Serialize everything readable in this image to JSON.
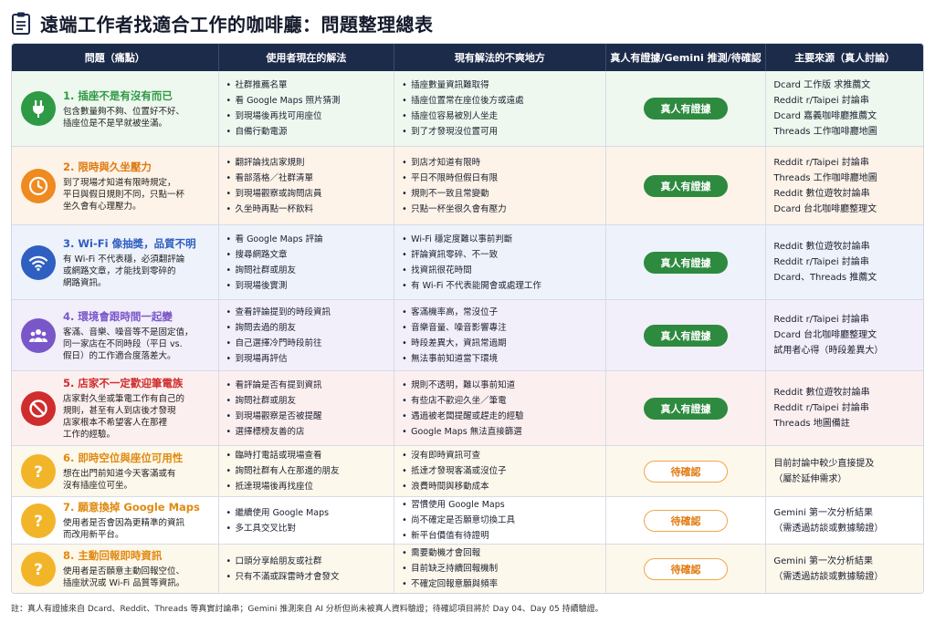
{
  "title": "遠端工作者找適合工作的咖啡廳：問題整理總表",
  "headers": [
    "問題（痛點）",
    "使用者現在的解法",
    "現有解法的不爽地方",
    "真人有證據/Gemini 推測/待確認",
    "主要來源（真人討論）"
  ],
  "colors": {
    "header_bg": "#1c2b4a",
    "green": "#2f9a45",
    "orange": "#ee8a1f",
    "blue": "#2f5fc0",
    "purple": "#7a57c8",
    "red": "#cf2d2d",
    "yellow": "#f2b52a"
  },
  "rows": [
    {
      "icon": "plug-icon",
      "title": "1. 插座不是有沒有而已",
      "desc": [
        "包含數量夠不夠、位置好不好、",
        "插座位是不是早就被坐滿。"
      ],
      "solutions": [
        "社群推薦名單",
        "看 Google Maps 照片猜測",
        "到現場後再找可用座位",
        "自備行動電源"
      ],
      "pains": [
        "插座數量資訊難取得",
        "插座位置常在座位後方或遠處",
        "插座位容易被別人坐走",
        "到了才發現沒位置可用"
      ],
      "status": "真人有證據",
      "sources": [
        "Dcard 工作版 求推薦文",
        "Reddit r/Taipei 討論串",
        "Dcard 嘉義咖啡廳推薦文",
        "Threads 工作咖啡廳地圖"
      ]
    },
    {
      "icon": "clock-icon",
      "title": "2. 限時與久坐壓力",
      "desc": [
        "到了現場才知道有限時規定，",
        "平日與假日規則不同，只點一杯",
        "坐久會有心理壓力。"
      ],
      "solutions": [
        "翻評論找店家規則",
        "看部落格／社群清單",
        "到現場觀察或詢問店員",
        "久坐時再點一杯飲料"
      ],
      "pains": [
        "到店才知道有限時",
        "平日不限時但假日有限",
        "規則不一致且常變動",
        "只點一杯坐很久會有壓力"
      ],
      "status": "真人有證據",
      "sources": [
        "Reddit r/Taipei 討論串",
        "Threads 工作咖啡廳地圖",
        "Reddit 數位遊牧討論串",
        "Dcard 台北咖啡廳整理文"
      ]
    },
    {
      "icon": "wifi-icon",
      "title": "3. Wi-Fi 像抽獎，品質不明",
      "desc": [
        "有 Wi-Fi 不代表穩，必須翻評論",
        "或網路文章，才能找到零碎的",
        "網路資訊。"
      ],
      "solutions": [
        "看 Google Maps 評論",
        "搜尋網路文章",
        "詢問社群或朋友",
        "到現場後實測"
      ],
      "pains": [
        "Wi-Fi 穩定度難以事前判斷",
        "評論資訊零碎、不一致",
        "找資訊很花時間",
        "有 Wi-Fi 不代表能開會或處理工作"
      ],
      "status": "真人有證據",
      "sources": [
        "Reddit 數位遊牧討論串",
        "Reddit r/Taipei 討論串",
        "Dcard、Threads 推薦文"
      ]
    },
    {
      "icon": "people-icon",
      "title": "4. 環境會跟時間一起變",
      "desc": [
        "客滿、音樂、噪音等不是固定值，",
        "同一家店在不同時段（平日 vs.",
        "假日）的工作適合度落差大。"
      ],
      "solutions": [
        "查看評論提到的時段資訊",
        "詢問去過的朋友",
        "自己選擇冷門時段前往",
        "到現場再評估"
      ],
      "pains": [
        "客滿機率高，常沒位子",
        "音樂音量、噪音影響專注",
        "時段差異大，資訊常過期",
        "無法事前知道當下環境"
      ],
      "status": "真人有證據",
      "sources": [
        "Reddit r/Taipei 討論串",
        "Dcard 台北咖啡廳整理文",
        "試用者心得（時段差異大）"
      ]
    },
    {
      "icon": "no-entry-icon",
      "title": "5. 店家不一定歡迎筆電族",
      "desc": [
        "店家對久坐或筆電工作有自己的",
        "規則，甚至有人到店後才發現",
        "店家根本不希望客人在那裡",
        "工作的經驗。"
      ],
      "solutions": [
        "看評論是否有提到資訊",
        "詢問社群或朋友",
        "到現場觀察是否被提醒",
        "選擇標榜友善的店"
      ],
      "pains": [
        "規則不透明，難以事前知道",
        "有些店不歡迎久坐／筆電",
        "遇過被老闆提醒或趕走的經驗",
        "Google Maps 無法直接篩選"
      ],
      "status": "真人有證據",
      "sources": [
        "Reddit 數位遊牧討論串",
        "Reddit r/Taipei 討論串",
        "Threads 地圖備註"
      ]
    },
    {
      "icon": "question-icon",
      "title": "6. 即時空位與座位可用性",
      "desc": [
        "想在出門前知道今天客滿或有",
        "沒有插座位可坐。"
      ],
      "solutions": [
        "臨時打電話或現場查看",
        "詢問社群有人在那邊的朋友",
        "抵達現場後再找座位"
      ],
      "pains": [
        "沒有即時資訊可查",
        "抵達才發現客滿或沒位子",
        "浪費時間與移動成本"
      ],
      "status": "待確認",
      "sources": [
        "目前討論中較少直接提及",
        "（屬於延伸需求）"
      ]
    },
    {
      "icon": "question-icon",
      "title": "7. 願意換掉 Google Maps",
      "desc": [
        "使用者是否會因為更精準的資訊",
        "而改用新平台。"
      ],
      "solutions": [
        "繼續使用 Google Maps",
        "多工具交叉比對"
      ],
      "pains": [
        "習慣使用 Google Maps",
        "尚不確定是否願意切換工具",
        "新平台價值有待證明"
      ],
      "status": "待確認",
      "sources": [
        "Gemini 第一次分析結果",
        "（需透過訪談或數據驗證）"
      ]
    },
    {
      "icon": "question-icon",
      "title": "8. 主動回報即時資訊",
      "desc": [
        "使用者是否願意主動回報空位、",
        "插座狀況或 Wi-Fi 品質等資訊。"
      ],
      "solutions": [
        "口頭分享給朋友或社群",
        "只有不滿或踩雷時才會發文"
      ],
      "pains": [
        "需要動機才會回報",
        "目前缺乏持續回報機制",
        "不確定回報意願與頻率"
      ],
      "status": "待確認",
      "sources": [
        "Gemini 第一次分析結果",
        "（需透過訪談或數據驗證）"
      ]
    }
  ],
  "footnote": "註：真人有證據來自 Dcard、Reddit、Threads 等真實討論串；Gemini 推測來自 AI 分析但尚未被真人資料驗證；待確認項目將於 Day 04、Day 05 持續驗證。"
}
